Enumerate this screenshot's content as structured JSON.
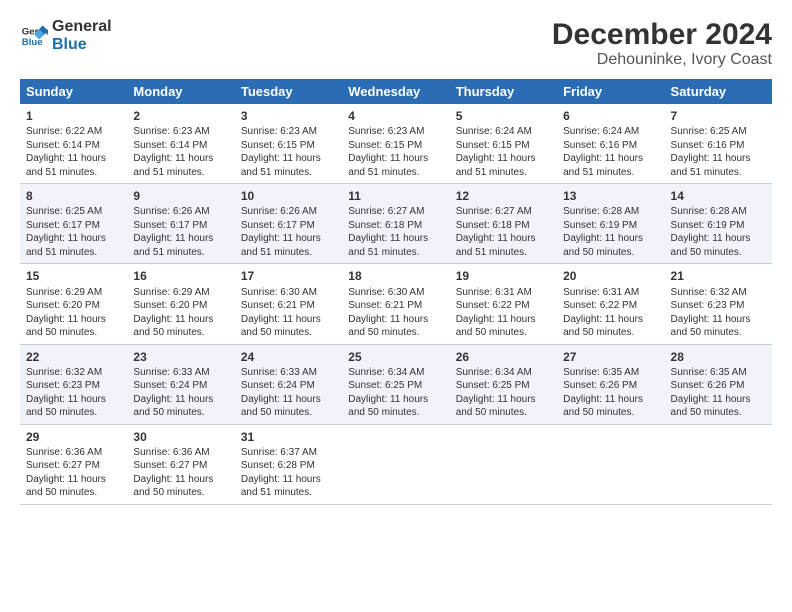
{
  "logo": {
    "line1": "General",
    "line2": "Blue"
  },
  "title": "December 2024",
  "subtitle": "Dehouninke, Ivory Coast",
  "days_header": [
    "Sunday",
    "Monday",
    "Tuesday",
    "Wednesday",
    "Thursday",
    "Friday",
    "Saturday"
  ],
  "weeks": [
    [
      {
        "day": "1",
        "info": "Sunrise: 6:22 AM\nSunset: 6:14 PM\nDaylight: 11 hours\nand 51 minutes."
      },
      {
        "day": "2",
        "info": "Sunrise: 6:23 AM\nSunset: 6:14 PM\nDaylight: 11 hours\nand 51 minutes."
      },
      {
        "day": "3",
        "info": "Sunrise: 6:23 AM\nSunset: 6:15 PM\nDaylight: 11 hours\nand 51 minutes."
      },
      {
        "day": "4",
        "info": "Sunrise: 6:23 AM\nSunset: 6:15 PM\nDaylight: 11 hours\nand 51 minutes."
      },
      {
        "day": "5",
        "info": "Sunrise: 6:24 AM\nSunset: 6:15 PM\nDaylight: 11 hours\nand 51 minutes."
      },
      {
        "day": "6",
        "info": "Sunrise: 6:24 AM\nSunset: 6:16 PM\nDaylight: 11 hours\nand 51 minutes."
      },
      {
        "day": "7",
        "info": "Sunrise: 6:25 AM\nSunset: 6:16 PM\nDaylight: 11 hours\nand 51 minutes."
      }
    ],
    [
      {
        "day": "8",
        "info": "Sunrise: 6:25 AM\nSunset: 6:17 PM\nDaylight: 11 hours\nand 51 minutes."
      },
      {
        "day": "9",
        "info": "Sunrise: 6:26 AM\nSunset: 6:17 PM\nDaylight: 11 hours\nand 51 minutes."
      },
      {
        "day": "10",
        "info": "Sunrise: 6:26 AM\nSunset: 6:17 PM\nDaylight: 11 hours\nand 51 minutes."
      },
      {
        "day": "11",
        "info": "Sunrise: 6:27 AM\nSunset: 6:18 PM\nDaylight: 11 hours\nand 51 minutes."
      },
      {
        "day": "12",
        "info": "Sunrise: 6:27 AM\nSunset: 6:18 PM\nDaylight: 11 hours\nand 51 minutes."
      },
      {
        "day": "13",
        "info": "Sunrise: 6:28 AM\nSunset: 6:19 PM\nDaylight: 11 hours\nand 50 minutes."
      },
      {
        "day": "14",
        "info": "Sunrise: 6:28 AM\nSunset: 6:19 PM\nDaylight: 11 hours\nand 50 minutes."
      }
    ],
    [
      {
        "day": "15",
        "info": "Sunrise: 6:29 AM\nSunset: 6:20 PM\nDaylight: 11 hours\nand 50 minutes."
      },
      {
        "day": "16",
        "info": "Sunrise: 6:29 AM\nSunset: 6:20 PM\nDaylight: 11 hours\nand 50 minutes."
      },
      {
        "day": "17",
        "info": "Sunrise: 6:30 AM\nSunset: 6:21 PM\nDaylight: 11 hours\nand 50 minutes."
      },
      {
        "day": "18",
        "info": "Sunrise: 6:30 AM\nSunset: 6:21 PM\nDaylight: 11 hours\nand 50 minutes."
      },
      {
        "day": "19",
        "info": "Sunrise: 6:31 AM\nSunset: 6:22 PM\nDaylight: 11 hours\nand 50 minutes."
      },
      {
        "day": "20",
        "info": "Sunrise: 6:31 AM\nSunset: 6:22 PM\nDaylight: 11 hours\nand 50 minutes."
      },
      {
        "day": "21",
        "info": "Sunrise: 6:32 AM\nSunset: 6:23 PM\nDaylight: 11 hours\nand 50 minutes."
      }
    ],
    [
      {
        "day": "22",
        "info": "Sunrise: 6:32 AM\nSunset: 6:23 PM\nDaylight: 11 hours\nand 50 minutes."
      },
      {
        "day": "23",
        "info": "Sunrise: 6:33 AM\nSunset: 6:24 PM\nDaylight: 11 hours\nand 50 minutes."
      },
      {
        "day": "24",
        "info": "Sunrise: 6:33 AM\nSunset: 6:24 PM\nDaylight: 11 hours\nand 50 minutes."
      },
      {
        "day": "25",
        "info": "Sunrise: 6:34 AM\nSunset: 6:25 PM\nDaylight: 11 hours\nand 50 minutes."
      },
      {
        "day": "26",
        "info": "Sunrise: 6:34 AM\nSunset: 6:25 PM\nDaylight: 11 hours\nand 50 minutes."
      },
      {
        "day": "27",
        "info": "Sunrise: 6:35 AM\nSunset: 6:26 PM\nDaylight: 11 hours\nand 50 minutes."
      },
      {
        "day": "28",
        "info": "Sunrise: 6:35 AM\nSunset: 6:26 PM\nDaylight: 11 hours\nand 50 minutes."
      }
    ],
    [
      {
        "day": "29",
        "info": "Sunrise: 6:36 AM\nSunset: 6:27 PM\nDaylight: 11 hours\nand 50 minutes."
      },
      {
        "day": "30",
        "info": "Sunrise: 6:36 AM\nSunset: 6:27 PM\nDaylight: 11 hours\nand 50 minutes."
      },
      {
        "day": "31",
        "info": "Sunrise: 6:37 AM\nSunset: 6:28 PM\nDaylight: 11 hours\nand 51 minutes."
      },
      {
        "day": "",
        "info": ""
      },
      {
        "day": "",
        "info": ""
      },
      {
        "day": "",
        "info": ""
      },
      {
        "day": "",
        "info": ""
      }
    ]
  ]
}
